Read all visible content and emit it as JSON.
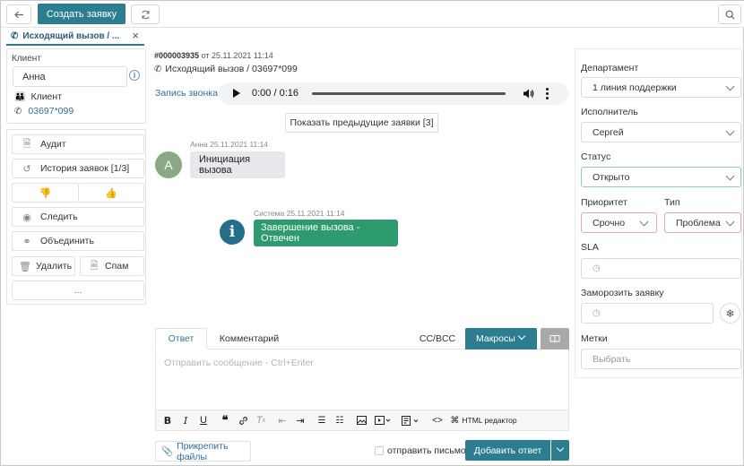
{
  "topbar": {
    "back_icon": "arrow-left-icon",
    "create_label": "Создать заявку",
    "refresh_icon": "refresh-icon",
    "search_icon": "search-icon"
  },
  "tab": {
    "label": "Исходящий вызов / ...",
    "icon": "phone-icon",
    "close": "×"
  },
  "client": {
    "title": "Клиент",
    "name": "Анна",
    "type_label": "Клиент",
    "phone": "03697*099"
  },
  "actions": {
    "audit": "Аудит",
    "history": "История заявок [1/3]",
    "follow": "Следить",
    "merge": "Объединить",
    "delete": "Удалить",
    "spam": "Спам",
    "more": "..."
  },
  "ticket": {
    "number": "#000003935",
    "date_prefix": "от",
    "date": "25.11.2021 11:14",
    "subject": "Исходящий вызов / 03697*099"
  },
  "audio": {
    "label": "Запись звонка",
    "time": "0:00 / 0:16"
  },
  "show_prev": "Показать предыдущие заявки [3]",
  "messages": [
    {
      "author": "Анна",
      "time": "25.11.2021 11:14",
      "avatar": "А",
      "text": "Инициация вызова"
    },
    {
      "author": "Система",
      "time": "25.11.2021 11:14",
      "avatar": "i",
      "text": "Завершение вызова - Отвечен"
    }
  ],
  "editor": {
    "tab_reply": "Ответ",
    "tab_comment": "Комментарий",
    "cc": "CC/BCC",
    "macros": "Макросы",
    "placeholder": "Отправить сообщение - Ctrl+Enter",
    "html_editor": "HTML редактор",
    "attach": "Прикрепить файлы",
    "send_mail": "отправить письмо",
    "submit": "Добавить ответ"
  },
  "right": {
    "department_label": "Департамент",
    "department_value": "1 линия поддержки",
    "assignee_label": "Исполнитель",
    "assignee_value": "Сергей",
    "status_label": "Статус",
    "status_value": "Открыто",
    "priority_label": "Приоритет",
    "priority_value": "Срочно",
    "type_label": "Тип",
    "type_value": "Проблема",
    "sla_label": "SLA",
    "freeze_label": "Заморозить заявку",
    "tags_label": "Метки",
    "tags_placeholder": "Выбрать"
  },
  "colors": {
    "primary": "#2b7d8f",
    "system_message": "#2e9b6f",
    "status_border": "#8fd1a3",
    "priority_border": "#e9a7a7",
    "link": "#2d6fa3"
  }
}
